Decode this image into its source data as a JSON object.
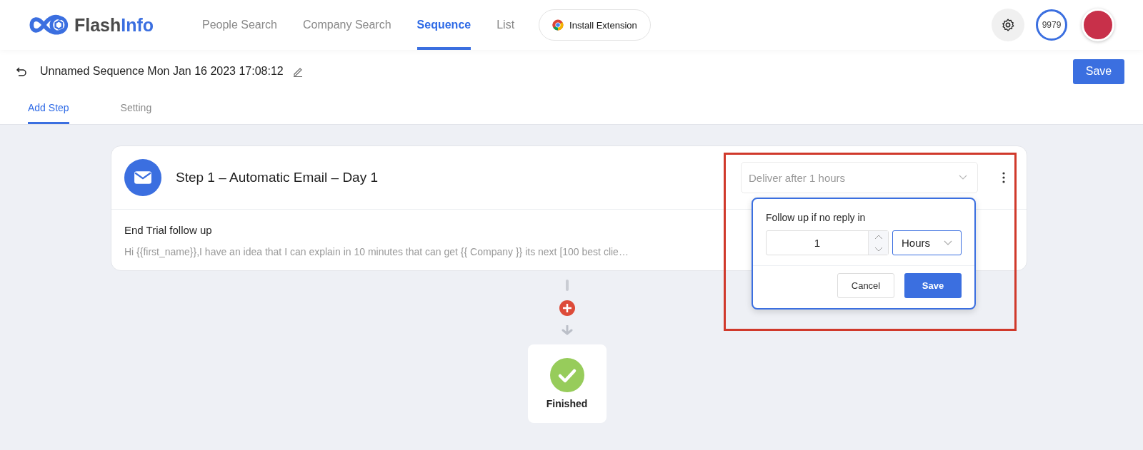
{
  "logo": {
    "part_1": "Flash",
    "part_2": "Info"
  },
  "nav": [
    {
      "label": "People Search",
      "selected": false
    },
    {
      "label": "Company Search",
      "selected": false
    },
    {
      "label": "Sequence",
      "selected": true
    },
    {
      "label": "List",
      "selected": false
    }
  ],
  "extension_button": "Install Extension",
  "credits": "9979",
  "sequence_title": "Unnamed Sequence Mon Jan 16 2023 17:08:12",
  "save_button": "Save",
  "tabs": [
    {
      "label": "Add Step",
      "selected": true
    },
    {
      "label": "Setting",
      "selected": false
    }
  ],
  "step": {
    "title": "Step 1 – Automatic Email – Day 1",
    "delivery": "Deliver after 1 hours",
    "subject": "End Trial follow up",
    "preview": "Hi {{first_name}},I have an idea that I can explain in 10 minutes that can get {{ Company }} its next [100 best clie…"
  },
  "popover": {
    "label": "Follow up if no reply in",
    "amount": "1",
    "unit": "Hours",
    "cancel": "Cancel",
    "save": "Save"
  },
  "finish": {
    "label": "Finished"
  }
}
